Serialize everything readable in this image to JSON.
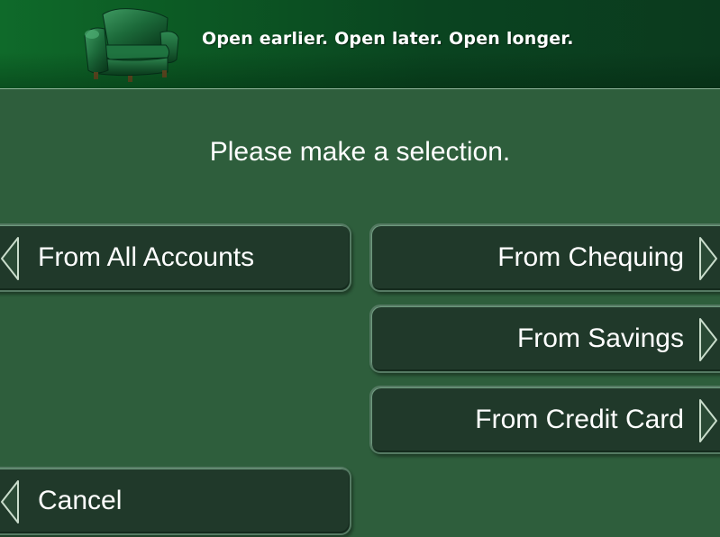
{
  "banner": {
    "slogan": "Open earlier. Open later. Open longer.",
    "image": "armchair-icon"
  },
  "prompt": "Please make a selection.",
  "buttons": {
    "all_accounts": "From All Accounts",
    "chequing": "From Chequing",
    "savings": "From Savings",
    "credit_card": "From Credit Card",
    "cancel": "Cancel"
  },
  "colors": {
    "background": "#2e5e3c",
    "button_fill": "#20392a",
    "button_border": "#557a63",
    "banner_green": "#0f6a2a",
    "text": "#ffffff"
  }
}
